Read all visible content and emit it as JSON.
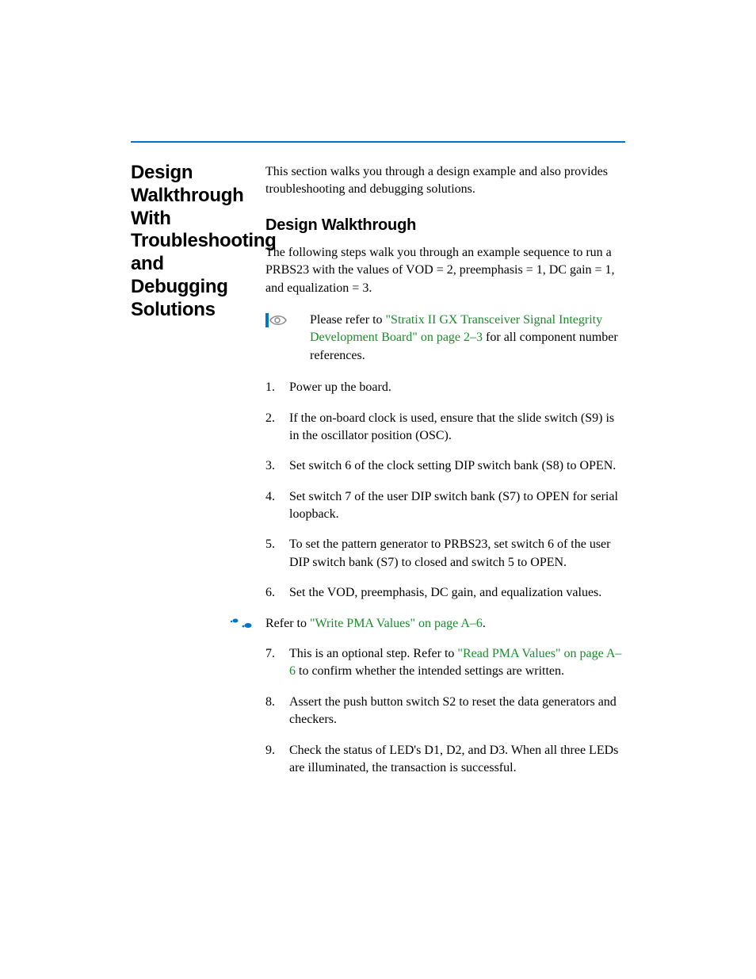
{
  "sidebar": {
    "heading": "Design Walkthrough With Troubleshooting and Debugging Solutions"
  },
  "intro": "This section walks you through a design example and also provides troubleshooting and debugging solutions.",
  "section": {
    "title": "Design Walkthrough",
    "lead": "The following steps walk you through an example sequence to run a PRBS23 with the values of VOD = 2, preemphasis = 1, DC gain = 1, and equalization = 3."
  },
  "note": {
    "pre": "Please refer to ",
    "link": "\"Stratix II GX Transceiver Signal Integrity Development Board\" on page 2–3",
    "post": " for all component number references."
  },
  "steps_a": [
    "Power up the board.",
    "If the on-board clock is used, ensure that the slide switch (S9) is in the oscillator position (OSC).",
    "Set switch 6 of the clock setting DIP switch bank (S8) to OPEN.",
    "Set switch 7 of the user DIP switch bank (S7) to OPEN for serial loopback.",
    "To set the pattern generator to PRBS23, set switch 6 of the user DIP switch bank (S7) to closed and switch 5 to OPEN.",
    "Set the VOD, preemphasis, DC gain, and equalization values."
  ],
  "refer": {
    "pre": "Refer to ",
    "link": "\"Write PMA Values\" on page A–6",
    "post": "."
  },
  "step7": {
    "pre": "This is an optional step. Refer to ",
    "link": "\"Read PMA Values\" on page A–6",
    "post": " to confirm whether the intended settings are written."
  },
  "steps_b": [
    "Assert the push button switch S2 to reset the data generators and checkers.",
    "Check the status of LED's D1, D2, and D3. When all three LEDs are illuminated, the transaction is successful."
  ]
}
